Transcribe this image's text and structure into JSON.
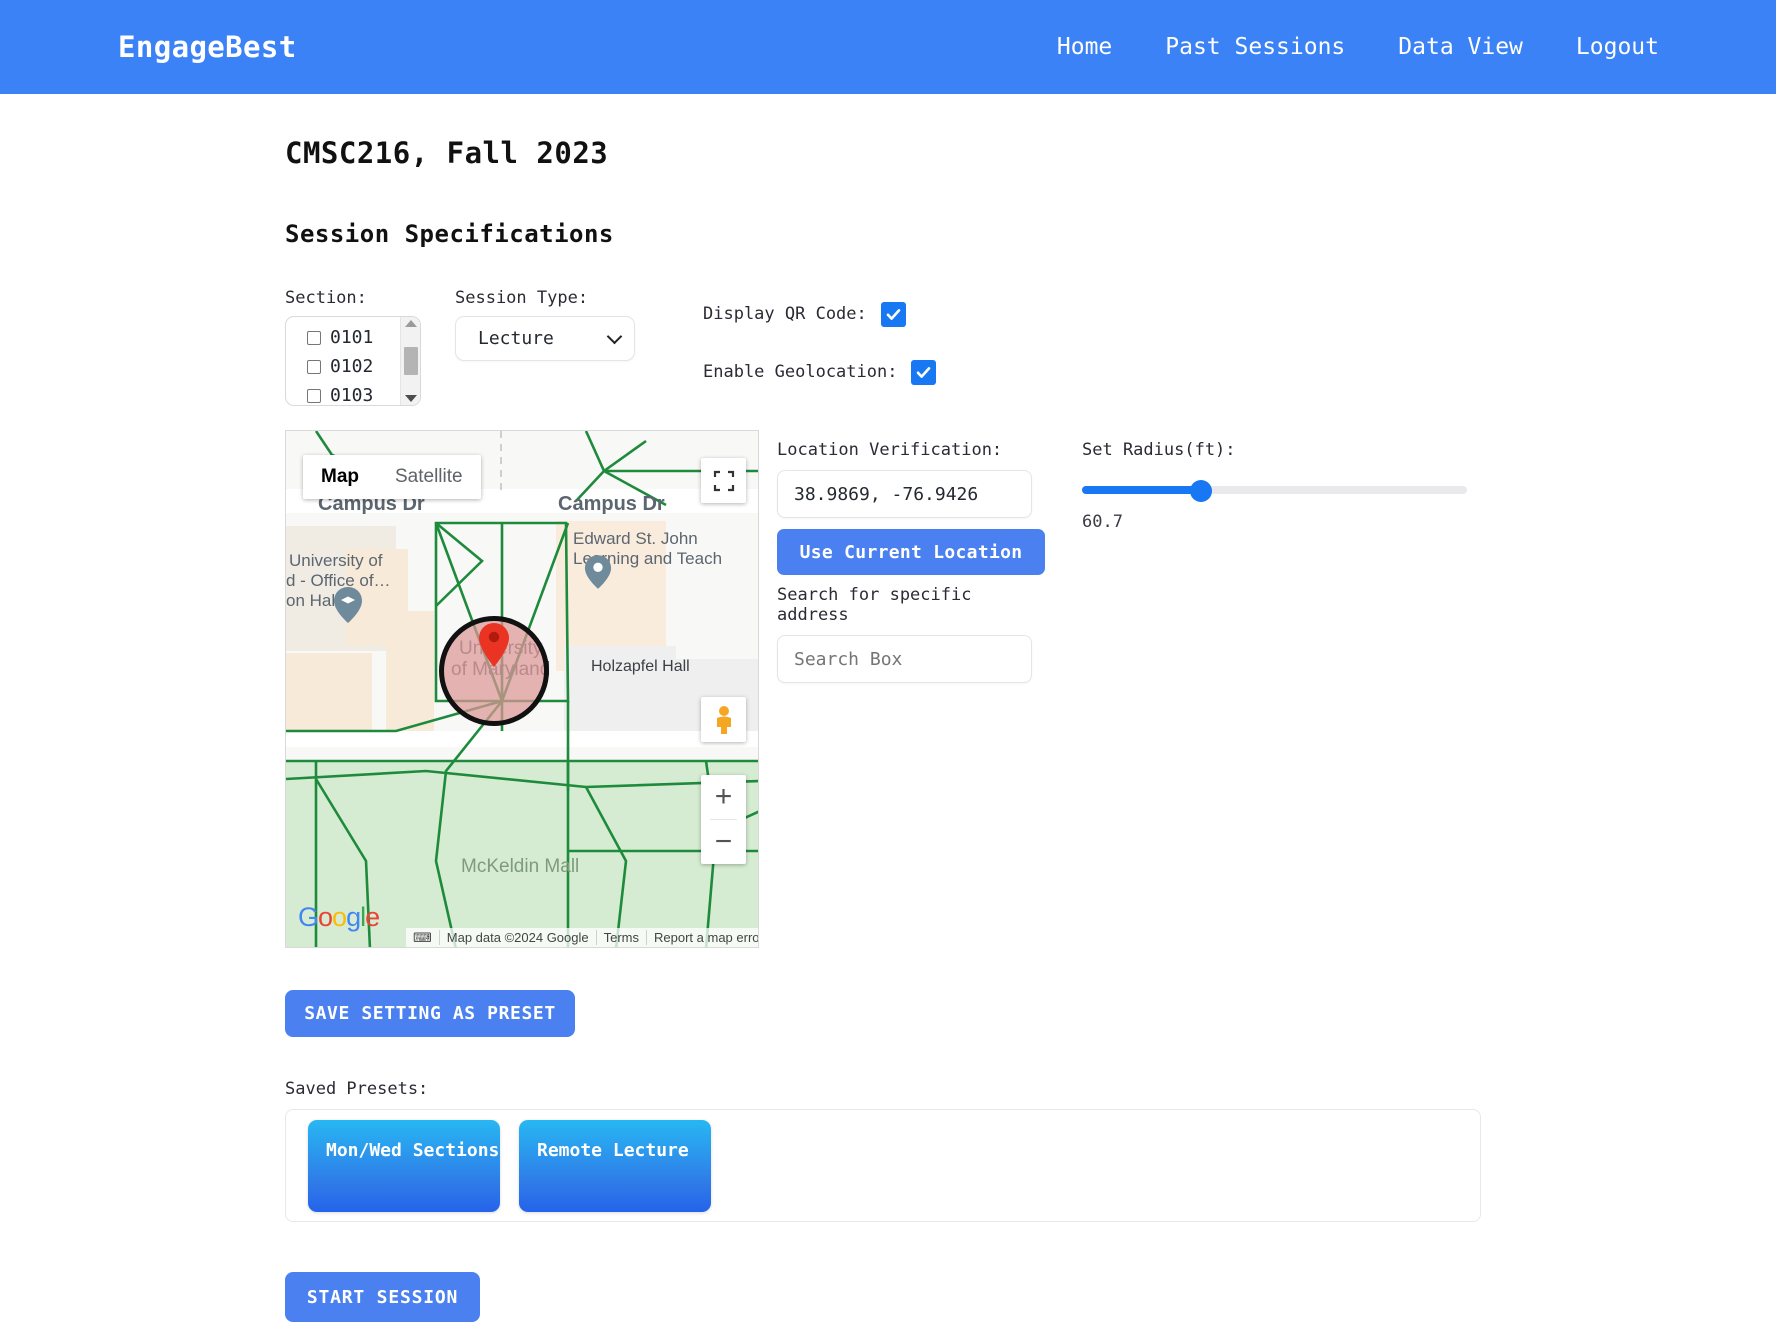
{
  "header": {
    "brand": "EngageBest",
    "nav": [
      {
        "label": "Home"
      },
      {
        "label": "Past Sessions"
      },
      {
        "label": "Data View"
      },
      {
        "label": "Logout"
      }
    ]
  },
  "page": {
    "course_title": "CMSC216, Fall 2023",
    "section_heading": "Session Specifications"
  },
  "section_field": {
    "label": "Section:",
    "options": [
      {
        "value": "0101",
        "checked": false
      },
      {
        "value": "0102",
        "checked": false
      },
      {
        "value": "0103",
        "checked": false
      }
    ]
  },
  "session_type": {
    "label": "Session Type:",
    "selected": "Lecture"
  },
  "toggles": {
    "qr": {
      "label": "Display QR Code:",
      "checked": true
    },
    "geo": {
      "label": "Enable Geolocation:",
      "checked": true
    }
  },
  "location": {
    "label": "Location Verification:",
    "coordinates": "38.9869, -76.9426",
    "use_current_button": "Use Current Location",
    "search_label": "Search for specific address",
    "search_placeholder": "Search Box",
    "search_value": ""
  },
  "radius": {
    "label": "Set Radius(ft):",
    "value": "60.7",
    "percent": 31
  },
  "map": {
    "types": [
      {
        "label": "Map",
        "active": true
      },
      {
        "label": "Satellite",
        "active": false
      }
    ],
    "labels": [
      {
        "text": "Campus Dr"
      },
      {
        "text": "Campus Dr"
      },
      {
        "text": "Edward St. John"
      },
      {
        "text": "Learning and Teach"
      },
      {
        "text": "University of"
      },
      {
        "text": "d - Office of…"
      },
      {
        "text": "on Hall"
      },
      {
        "text": "University"
      },
      {
        "text": "of Maryland"
      },
      {
        "text": "Holzapfel Hall"
      },
      {
        "text": "McKeldin Mall"
      }
    ],
    "zoom_in": "+",
    "zoom_out": "−",
    "logo": "Google",
    "attribution": [
      {
        "text": "Map data ©2024 Google"
      },
      {
        "text": "Terms"
      },
      {
        "text": "Report a map error"
      }
    ]
  },
  "presets": {
    "save_button": "SAVE SETTING AS PRESET",
    "saved_label": "Saved Presets:",
    "items": [
      {
        "name": "Mon/Wed Sections"
      },
      {
        "name": "Remote Lecture"
      }
    ]
  },
  "start_button": "START SESSION"
}
